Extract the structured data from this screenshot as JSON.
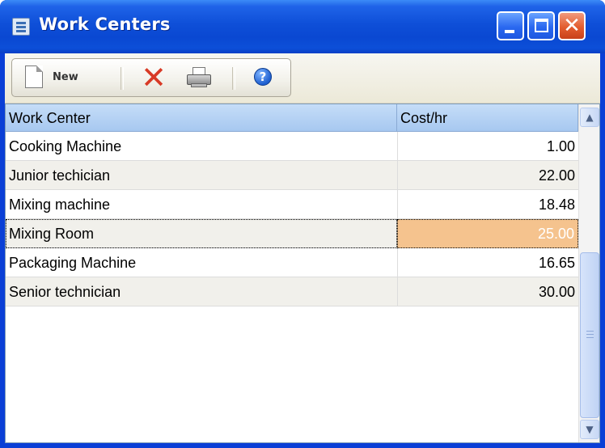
{
  "window": {
    "title": "Work Centers",
    "icons": {
      "app": "window-list-icon",
      "minimize": "minimize-icon",
      "maximize": "maximize-icon",
      "close": "close-icon"
    }
  },
  "toolbar": {
    "new_label": "New",
    "icons": {
      "new": "new-document-icon",
      "delete": "delete-x-icon",
      "print": "printer-icon",
      "help": "help-icon"
    }
  },
  "grid": {
    "columns": [
      "Work Center",
      "Cost/hr"
    ],
    "rows": [
      {
        "name": "Cooking Machine",
        "cost": "1.00"
      },
      {
        "name": "Junior techician",
        "cost": "22.00"
      },
      {
        "name": "Mixing machine",
        "cost": "18.48"
      },
      {
        "name": "Mixing Room",
        "cost": "25.00",
        "selected": true
      },
      {
        "name": "Packaging Machine",
        "cost": "16.65"
      },
      {
        "name": "Senior technician",
        "cost": "30.00"
      }
    ]
  },
  "colors": {
    "titlebar": "#0a48d2",
    "selected_cell": "#f5c38e",
    "header": "#b4d0f3"
  }
}
